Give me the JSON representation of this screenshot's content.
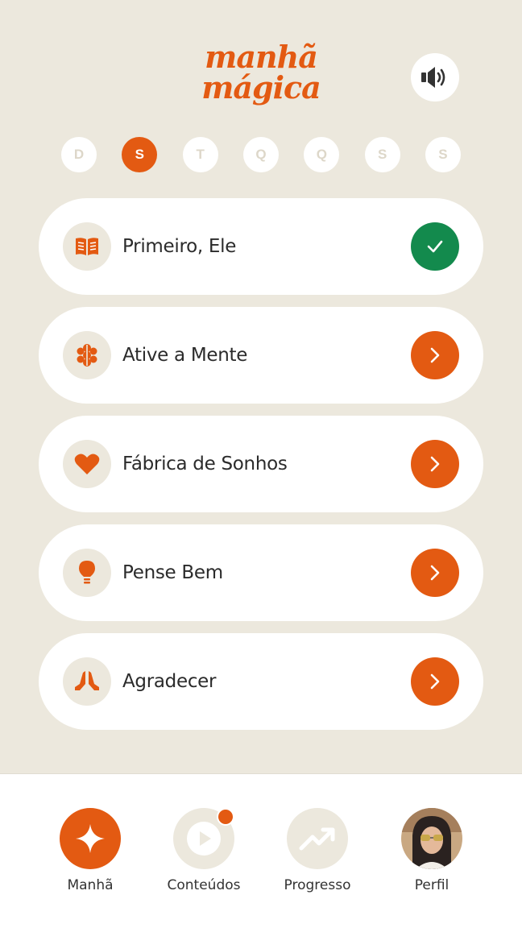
{
  "header": {
    "logo_line1": "manhã",
    "logo_line2": "mágica",
    "sound_icon": "speaker-volume-icon"
  },
  "days": [
    {
      "letter": "D",
      "active": false
    },
    {
      "letter": "S",
      "active": true
    },
    {
      "letter": "T",
      "active": false
    },
    {
      "letter": "Q",
      "active": false
    },
    {
      "letter": "Q",
      "active": false
    },
    {
      "letter": "S",
      "active": false
    },
    {
      "letter": "S",
      "active": false
    }
  ],
  "tasks": [
    {
      "label": "Primeiro, Ele",
      "icon": "open-book-icon",
      "status": "done"
    },
    {
      "label": "Ative a Mente",
      "icon": "brain-icon",
      "status": "pending"
    },
    {
      "label": "Fábrica de Sonhos",
      "icon": "heart-icon",
      "status": "pending"
    },
    {
      "label": "Pense Bem",
      "icon": "lightbulb-icon",
      "status": "pending"
    },
    {
      "label": "Agradecer",
      "icon": "praying-hands-icon",
      "status": "pending"
    }
  ],
  "nav": {
    "items": [
      {
        "label": "Manhã",
        "icon": "sparkle-icon",
        "active": true
      },
      {
        "label": "Conteúdos",
        "icon": "play-icon",
        "notification": true
      },
      {
        "label": "Progresso",
        "icon": "trending-up-icon"
      },
      {
        "label": "Perfil",
        "icon": "avatar"
      }
    ]
  },
  "colors": {
    "accent": "#E35A12",
    "success": "#138A4D",
    "background": "#ECE8DD"
  }
}
